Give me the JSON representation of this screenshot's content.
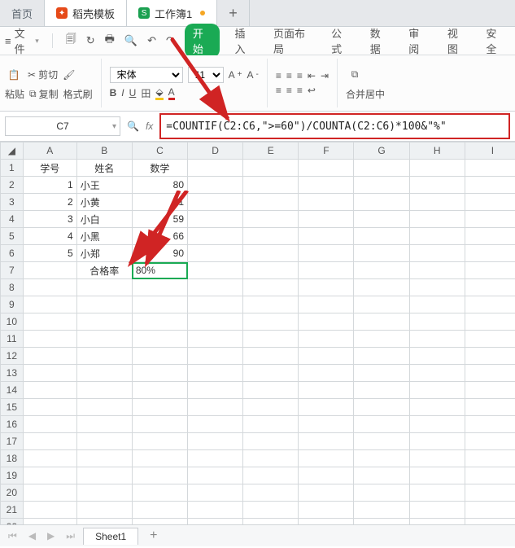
{
  "tabs": {
    "home": "首页",
    "app": "稻壳模板",
    "sheet": "工作簿1"
  },
  "file_menu": {
    "file": "文件",
    "start": "开始",
    "insert": "插入",
    "page": "页面布局",
    "formula": "公式",
    "data": "数据",
    "review": "审阅",
    "view": "视图",
    "safe": "安全"
  },
  "ribbon": {
    "paste": "粘贴",
    "cut": "剪切",
    "copy": "复制",
    "format_painter": "格式刷",
    "font_name": "宋体",
    "font_size": "11",
    "merge": "合并居中"
  },
  "namebox": "C7",
  "fx_label": "fx",
  "formula": "=COUNTIF(C2:C6,\">=60\")/COUNTA(C2:C6)*100&\"%\"",
  "columns": [
    "A",
    "B",
    "C",
    "D",
    "E",
    "F",
    "G",
    "H",
    "I"
  ],
  "headers": {
    "A": "学号",
    "B": "姓名",
    "C": "数学"
  },
  "rows": [
    {
      "A": "1",
      "B": "小王",
      "C": "80"
    },
    {
      "A": "2",
      "B": "小黄",
      "C": "71"
    },
    {
      "A": "3",
      "B": "小白",
      "C": "59"
    },
    {
      "A": "4",
      "B": "小黑",
      "C": "66"
    },
    {
      "A": "5",
      "B": "小郑",
      "C": "90"
    }
  ],
  "summary_row": {
    "B": "合格率",
    "C": "80%"
  },
  "sheet_tab": "Sheet1"
}
